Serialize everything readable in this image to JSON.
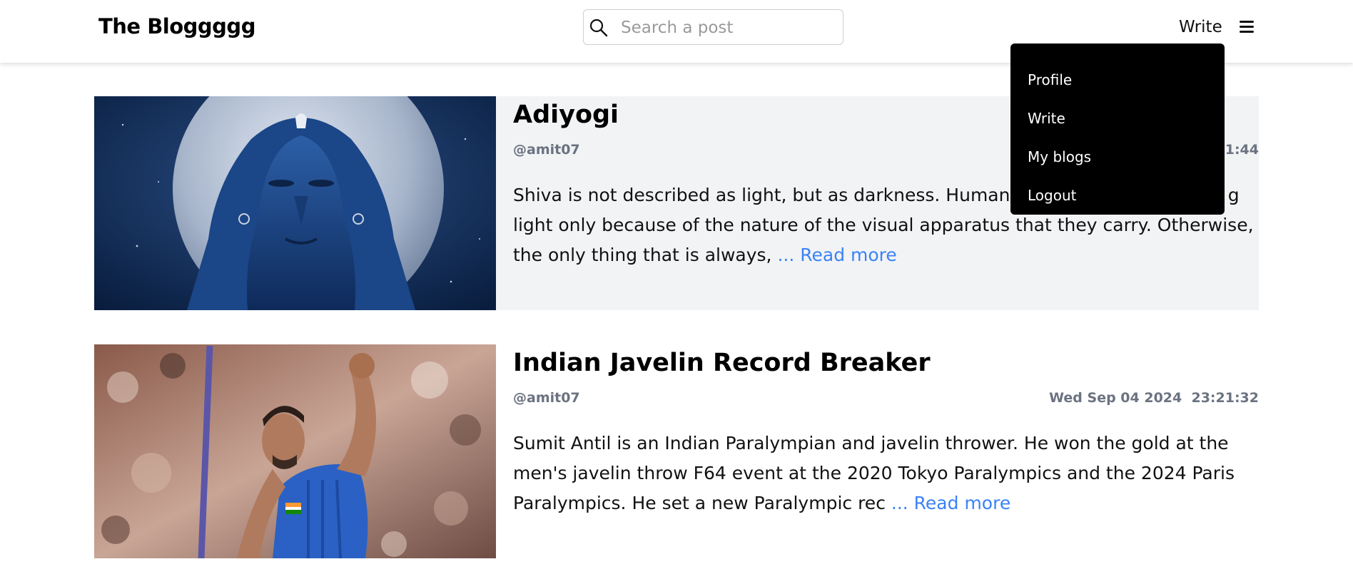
{
  "header": {
    "brand": "The Bloggggg",
    "search_placeholder": "Search a post",
    "write_label": "Write"
  },
  "dropdown": {
    "items": [
      {
        "label": "Profile"
      },
      {
        "label": "Write"
      },
      {
        "label": "My blogs"
      },
      {
        "label": "Logout"
      }
    ]
  },
  "posts": [
    {
      "title": "Adiyogi",
      "author": "@amit07",
      "date_visible": ":11:44",
      "excerpt": "Shiva is not described as light, but as darkness. Humanity h",
      "excerpt_rest": "g light only because of the nature of the visual apparatus that they carry. Otherwise, the only thing that is always,",
      "read_more": "... Read more",
      "image_icon": "shiva-statue-image"
    },
    {
      "title": "Indian Javelin Record Breaker",
      "author": "@amit07",
      "date": "Wed Sep 04 2024",
      "time": "23:21:32",
      "excerpt": "Sumit Antil is an Indian Paralympian and javelin thrower. He won the gold at the men's javelin throw F64 event at the 2020 Tokyo Paralympics and the 2024 Paris Paralympics. He set a new Paralympic rec",
      "read_more": "... Read more",
      "image_icon": "javelin-athlete-image"
    }
  ],
  "colors": {
    "accent": "#3b82f6",
    "muted": "#6b7280",
    "card_bg": "#f2f3f5",
    "dropdown_bg": "#000000"
  }
}
